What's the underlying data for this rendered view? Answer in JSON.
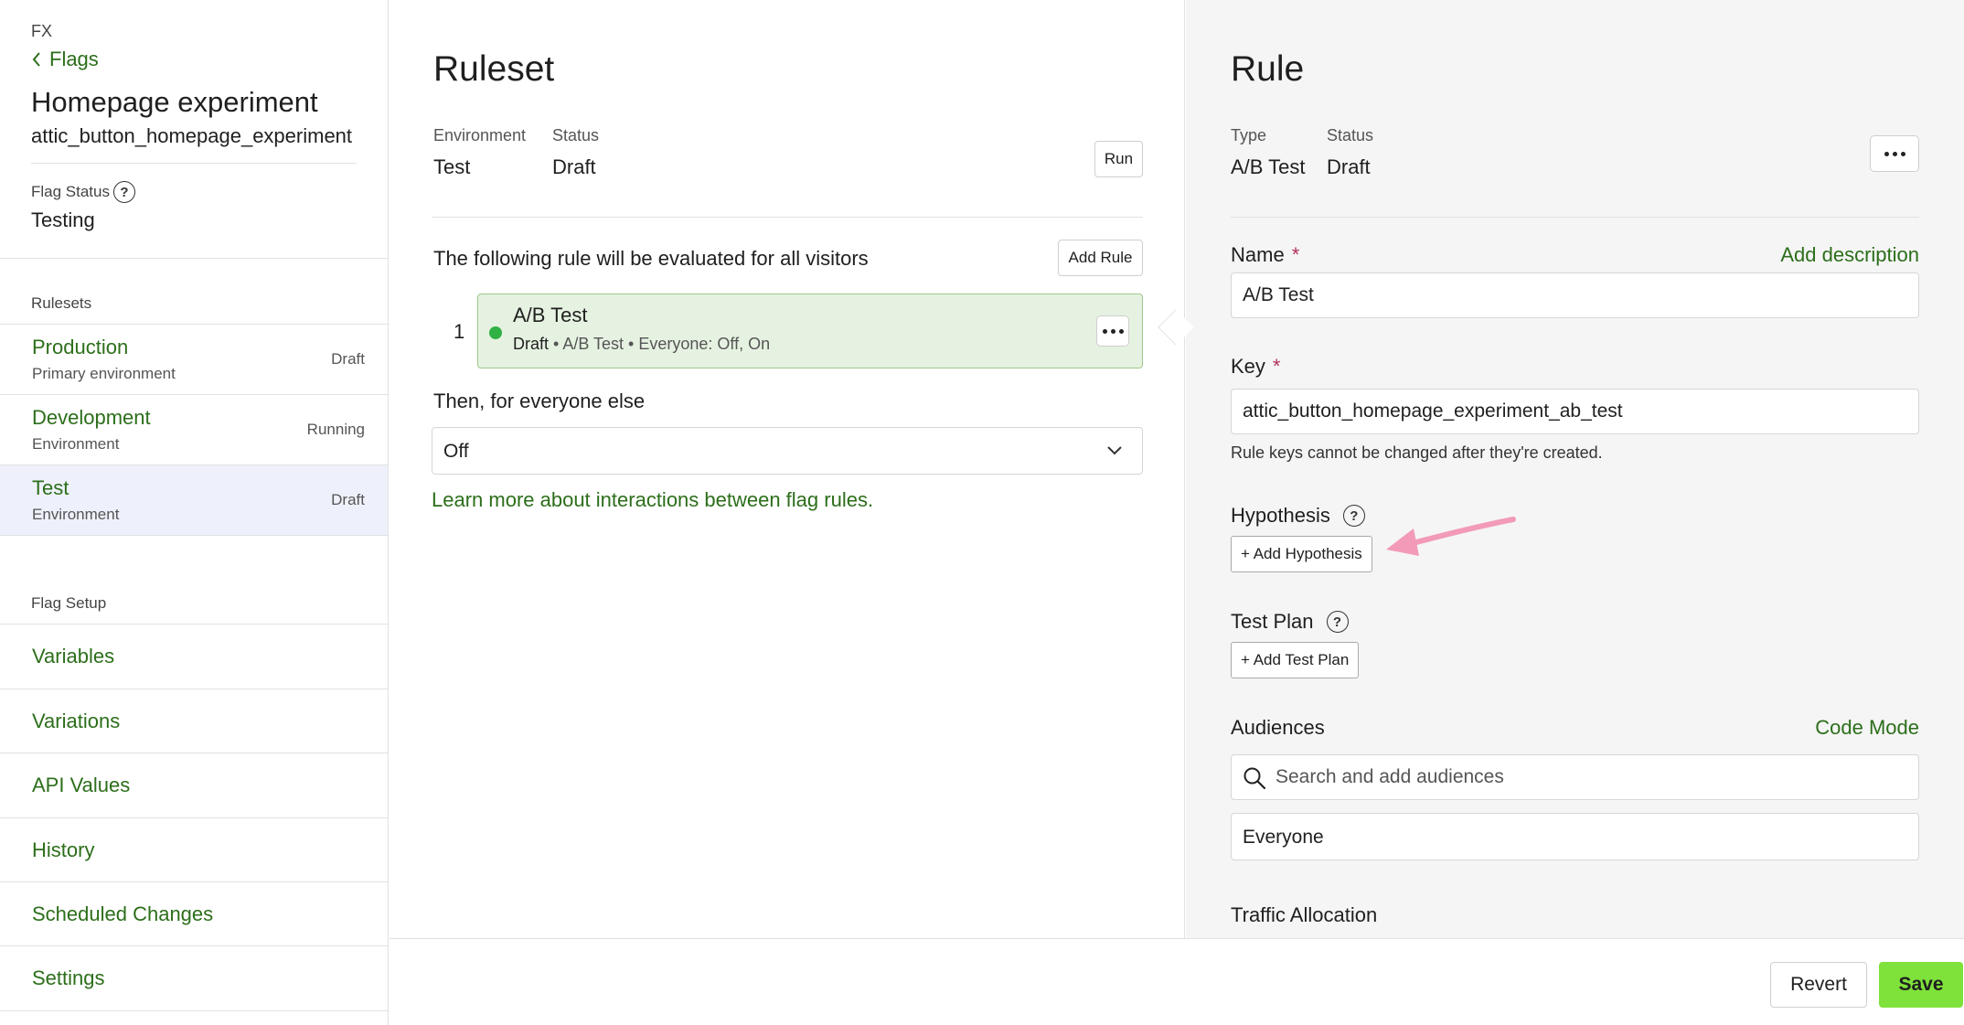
{
  "sidebar": {
    "product": "FX",
    "back_label": "Flags",
    "flag_name": "Homepage experiment",
    "flag_key": "attic_button_homepage_experiment",
    "flag_status_label": "Flag Status",
    "flag_status_value": "Testing",
    "rulesets_heading": "Rulesets",
    "environments": [
      {
        "name": "Production",
        "description": "Primary environment",
        "status": "Draft"
      },
      {
        "name": "Development",
        "description": "Environment",
        "status": "Running"
      },
      {
        "name": "Test",
        "description": "Environment",
        "status": "Draft"
      }
    ],
    "setup_heading": "Flag Setup",
    "setup_links": [
      "Variables",
      "Variations",
      "API Values",
      "History",
      "Scheduled Changes",
      "Settings"
    ]
  },
  "ruleset": {
    "title": "Ruleset",
    "environment_label": "Environment",
    "environment_value": "Test",
    "status_label": "Status",
    "status_value": "Draft",
    "run_label": "Run",
    "intro": "The following rule will be evaluated for all visitors",
    "add_rule_label": "Add Rule",
    "rule": {
      "index": "1",
      "name": "A/B Test",
      "status": "Draft",
      "type": "A/B Test",
      "audience_summary": "Everyone: Off, On"
    },
    "fallback_label": "Then, for everyone else",
    "fallback_value": "Off",
    "learn_more": "Learn more about interactions between flag rules."
  },
  "rule": {
    "title": "Rule",
    "type_label": "Type",
    "type_value": "A/B Test",
    "status_label": "Status",
    "status_value": "Draft",
    "name_label": "Name",
    "name_value": "A/B Test",
    "add_description": "Add description",
    "key_label": "Key",
    "key_value": "attic_button_homepage_experiment_ab_test",
    "key_hint": "Rule keys cannot be changed after they're created.",
    "hypothesis_label": "Hypothesis",
    "add_hypothesis": "+ Add Hypothesis",
    "test_plan_label": "Test Plan",
    "add_test_plan": "+ Add Test Plan",
    "audiences_label": "Audiences",
    "code_mode": "Code Mode",
    "audience_search_placeholder": "Search and add audiences",
    "audience_item": "Everyone",
    "traffic_allocation_label": "Traffic Allocation"
  },
  "footer": {
    "revert_label": "Revert",
    "save_label": "Save"
  },
  "colors": {
    "accent_green": "#2c6e1a",
    "save_button": "#7ee23a",
    "rule_card_bg": "#e6f2e1",
    "rule_dot": "#2fb144",
    "annotation_arrow": "#f29ab8"
  },
  "icons": [
    "chevron-left-icon",
    "help-icon",
    "more-icon",
    "chevron-down-icon",
    "search-icon",
    "annotation-arrow"
  ]
}
